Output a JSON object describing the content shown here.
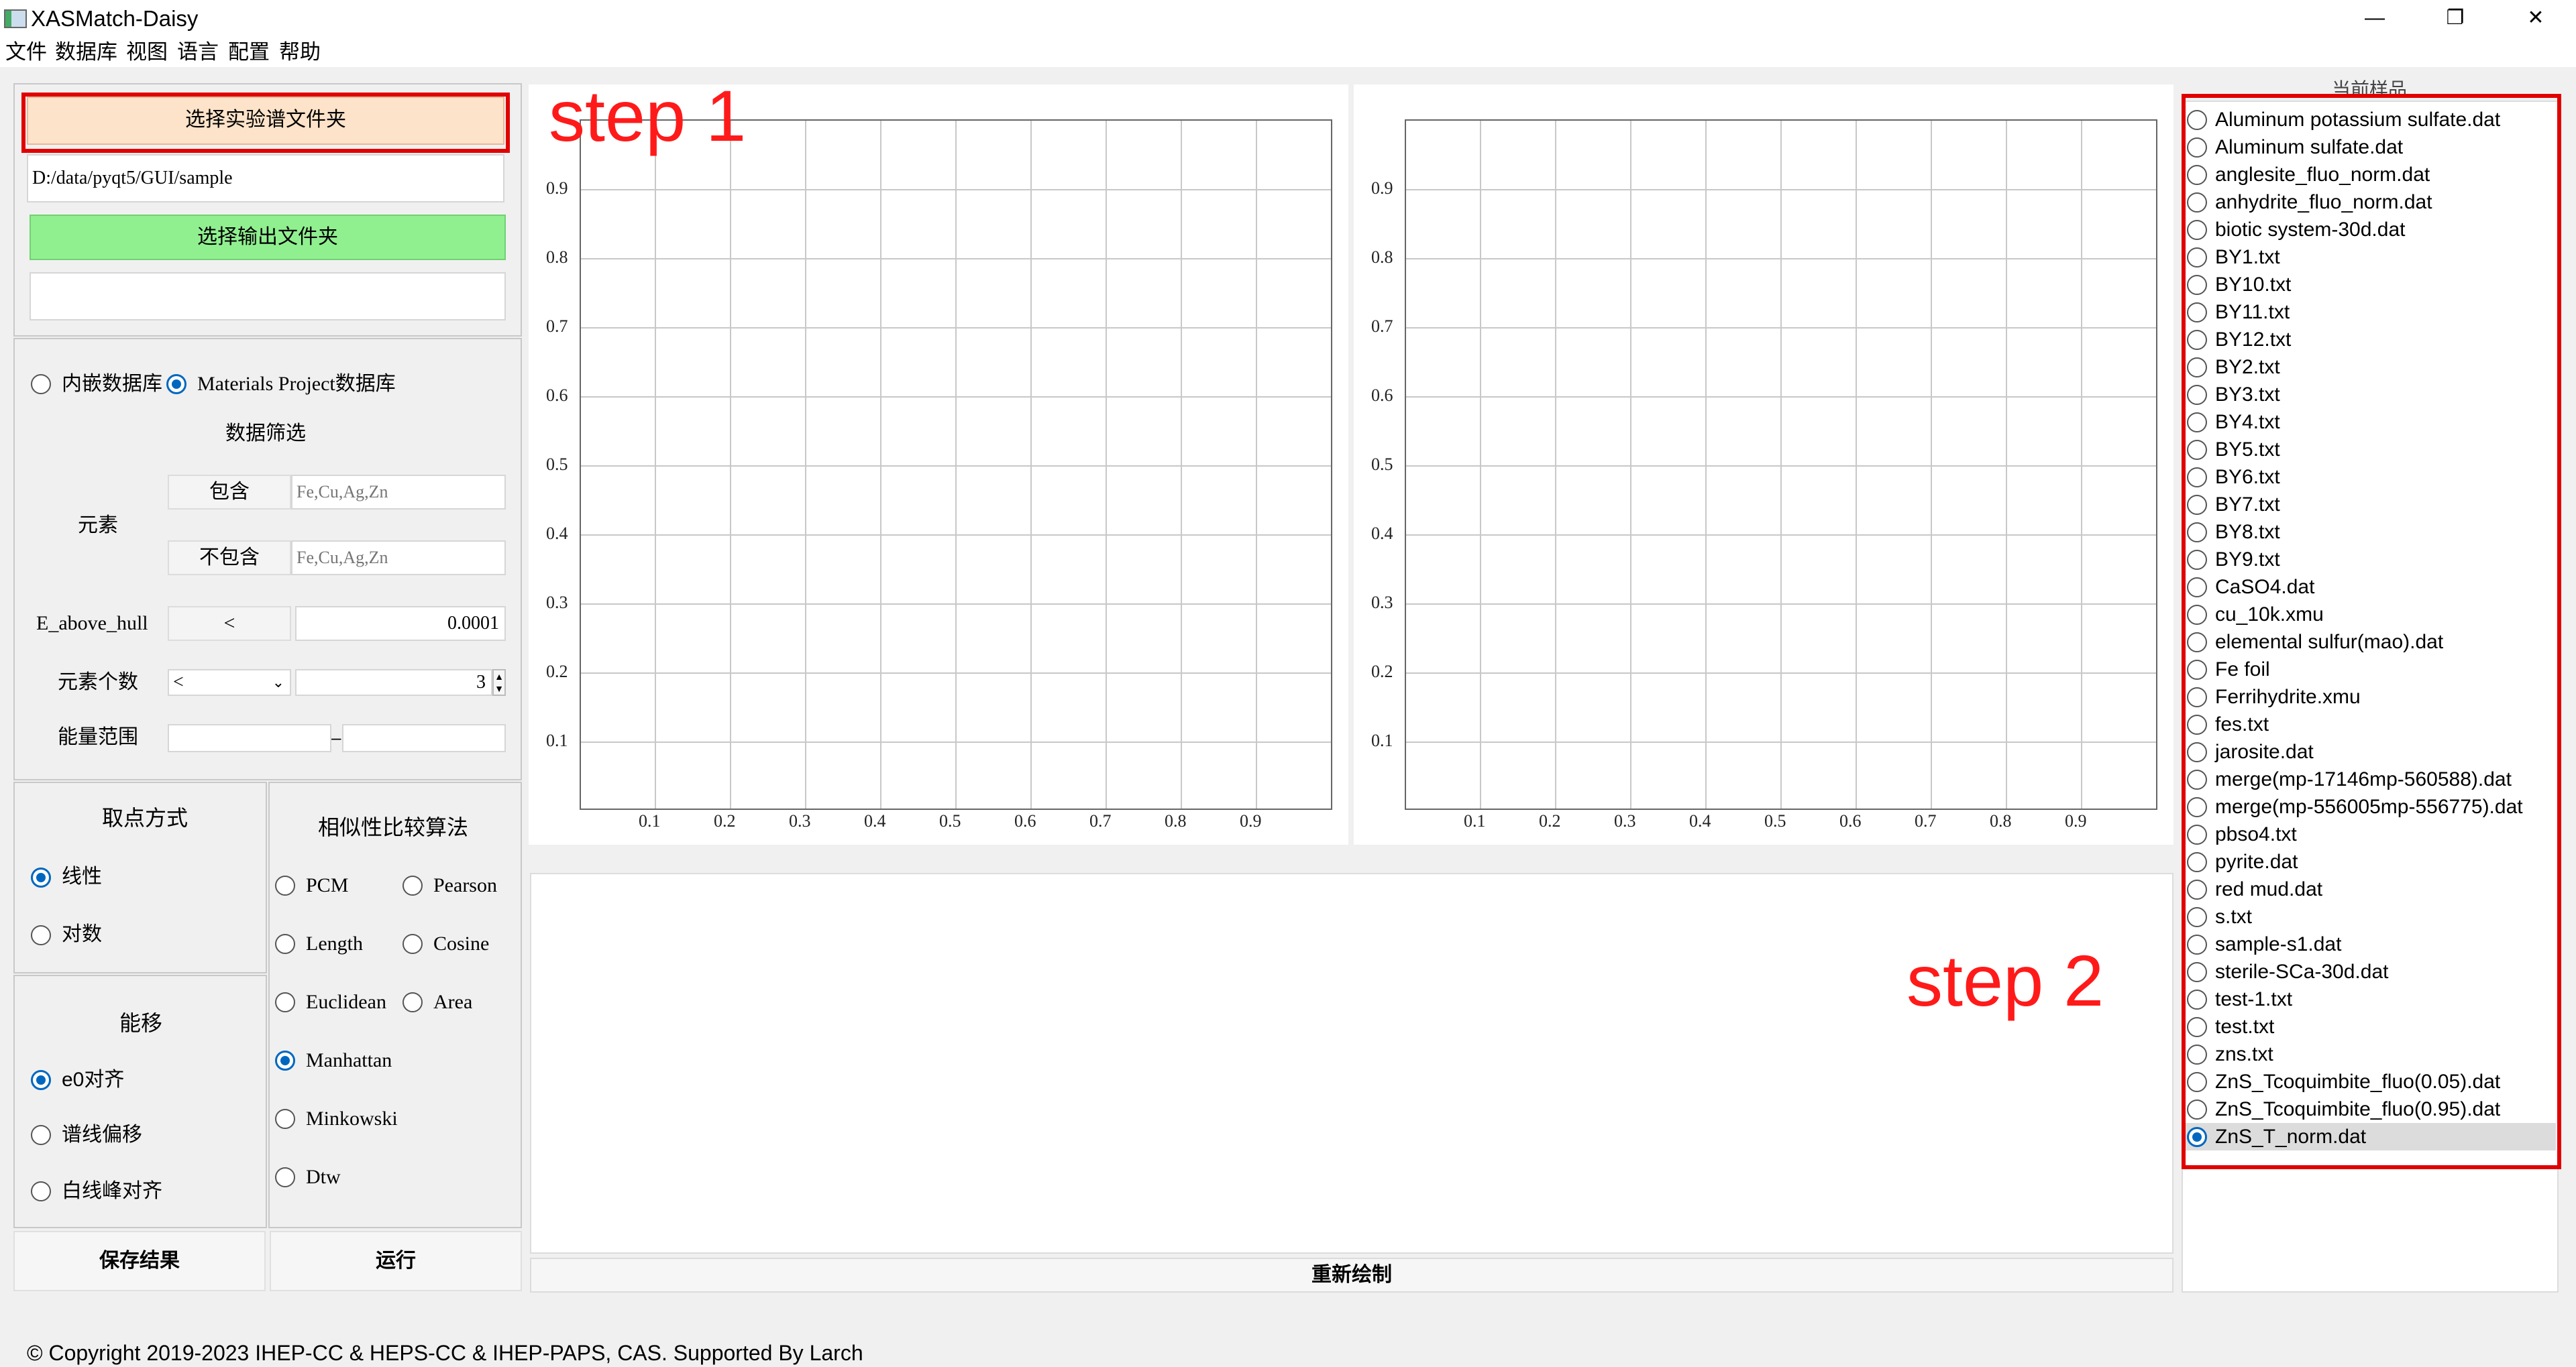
{
  "window": {
    "title": "XASMatch-Daisy",
    "minimize": "—",
    "restore": "❐",
    "close": "✕"
  },
  "menu": [
    "文件",
    "数据库",
    "视图",
    "语言",
    "配置",
    "帮助"
  ],
  "files": {
    "select_exp_folder": "选择实验谱文件夹",
    "exp_path": "D:/data/pyqt5/GUI/sample",
    "select_out_folder": "选择输出文件夹",
    "out_path": ""
  },
  "database": {
    "builtin": "内嵌数据库",
    "mp": "Materials Project数据库",
    "filter_title": "数据筛选",
    "element_label": "元素",
    "include_btn": "包含",
    "include_placeholder": "Fe,Cu,Ag,Zn",
    "exclude_btn": "不包含",
    "exclude_placeholder": "Fe,Cu,Ag,Zn",
    "e_above_hull_label": "E_above_hull",
    "e_above_hull_op": "<",
    "e_above_hull_value": "0.0001",
    "elem_count_label": "元素个数",
    "elem_count_op": "<",
    "elem_count_value": "3",
    "energy_range_label": "能量范围",
    "energy_sep": "–"
  },
  "sampling": {
    "title": "取点方式",
    "linear": "线性",
    "log": "对数"
  },
  "shift": {
    "title": "能移",
    "e0": "e0对齐",
    "spectrum": "谱线偏移",
    "whiteline": "白线峰对齐"
  },
  "algo": {
    "title": "相似性比较算法",
    "options": [
      "PCM",
      "Pearson",
      "Length",
      "Cosine",
      "Euclidean",
      "Area",
      "Manhattan",
      "Minkowski",
      "Dtw"
    ],
    "selected": "Manhattan"
  },
  "actions": {
    "save": "保存结果",
    "run": "运行",
    "redraw": "重新绘制"
  },
  "plots": {
    "y_ticks": [
      "0.9",
      "0.8",
      "0.7",
      "0.6",
      "0.5",
      "0.4",
      "0.3",
      "0.2",
      "0.1"
    ],
    "x_ticks": [
      "0.1",
      "0.2",
      "0.3",
      "0.4",
      "0.5",
      "0.6",
      "0.7",
      "0.8",
      "0.9"
    ]
  },
  "samples": {
    "title": "当前样品",
    "items": [
      "Aluminum potassium sulfate.dat",
      "Aluminum sulfate.dat",
      "anglesite_fluo_norm.dat",
      "anhydrite_fluo_norm.dat",
      "biotic system-30d.dat",
      "BY1.txt",
      "BY10.txt",
      "BY11.txt",
      "BY12.txt",
      "BY2.txt",
      "BY3.txt",
      "BY4.txt",
      "BY5.txt",
      "BY6.txt",
      "BY7.txt",
      "BY8.txt",
      "BY9.txt",
      "CaSO4.dat",
      "cu_10k.xmu",
      "elemental sulfur(mao).dat",
      "Fe foil",
      "Ferrihydrite.xmu",
      "fes.txt",
      "jarosite.dat",
      "merge(mp-17146mp-560588).dat",
      "merge(mp-556005mp-556775).dat",
      "pbso4.txt",
      "pyrite.dat",
      "red mud.dat",
      "s.txt",
      "sample-s1.dat",
      "sterile-SCa-30d.dat",
      "test-1.txt",
      "test.txt",
      "zns.txt",
      "ZnS_Tcoquimbite_fluo(0.05).dat",
      "ZnS_Tcoquimbite_fluo(0.95).dat",
      "ZnS_T_norm.dat"
    ],
    "selected_index": 37
  },
  "annotations": {
    "step1": "step 1",
    "step2": "step 2"
  },
  "footer": "© Copyright 2019-2023 IHEP-CC & HEPS-CC & IHEP-PAPS, CAS. Supported By Larch",
  "colors": {
    "accent": "#0067c0",
    "annotation": "#ff1a1a",
    "exp_button": "#fde3c9",
    "out_button": "#90f090"
  }
}
